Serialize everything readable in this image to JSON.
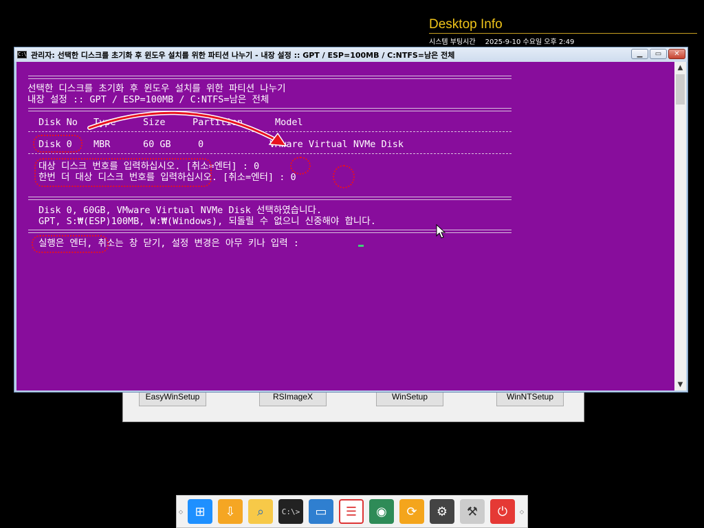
{
  "desktop_info": {
    "title": "Desktop Info",
    "label": "시스템 부팅시간",
    "value": "2025-9-10 수요일 오후 2:49"
  },
  "background_app": {
    "buttons": [
      "EasyWinSetup",
      "RSImageX",
      "WinSetup",
      "WinNTSetup"
    ]
  },
  "console_window": {
    "title": "관리자:  선택한 디스크를 초기화 후 윈도우 설치를 위한 파티션 나누기 - 내장 설정 :: GPT / ESP=100MB / C:NTFS=남은 전체",
    "icon": "cmd-icon",
    "lines": {
      "header1": "선택한 디스크를 초기화 후 윈도우 설치를 위한 파티션 나누기",
      "header2": "내장 설정 :: GPT / ESP=100MB / C:NTFS=남은 전체",
      "col_disk": "Disk No",
      "col_type": "Type",
      "col_size": "Size",
      "col_part": "Partition",
      "col_model": "Model",
      "row_disk": "Disk 0",
      "row_type": "MBR",
      "row_size": "60 GB",
      "row_part": "0",
      "row_model": "VMware Virtual NVMe Disk",
      "prompt1": "대상 디스크 번호를 입력하십시오. [취소=엔터] : 0",
      "prompt2": "한번 더 대상 디스크 번호를 입력하십시오. [취소=엔터] : 0",
      "confirm1": "Disk 0, 60GB, VMware Virtual NVMe Disk 선택하였습니다.",
      "confirm2": "GPT, S:₩(ESP)100MB, W:₩(Windows), 되돌릴 수 없으니 신중해야 합니다.",
      "exec": "실행은 엔터, 취소는 창 닫기, 설정 변경은 아무 키나 입력 : "
    }
  },
  "taskbar": {
    "icons": [
      "windows-icon",
      "usb-drive-icon",
      "folder-search-icon",
      "command-prompt-icon",
      "monitor-icon",
      "disk-partition-icon",
      "disk-tool-icon",
      "sync-icon",
      "settings-gear-icon",
      "hammer-tools-icon",
      "power-icon"
    ]
  },
  "colors": {
    "console_bg": "#880d9c",
    "annotation": "#e8121f",
    "cursor": "#3fd07a",
    "desktop_info_title": "#f0c419"
  }
}
